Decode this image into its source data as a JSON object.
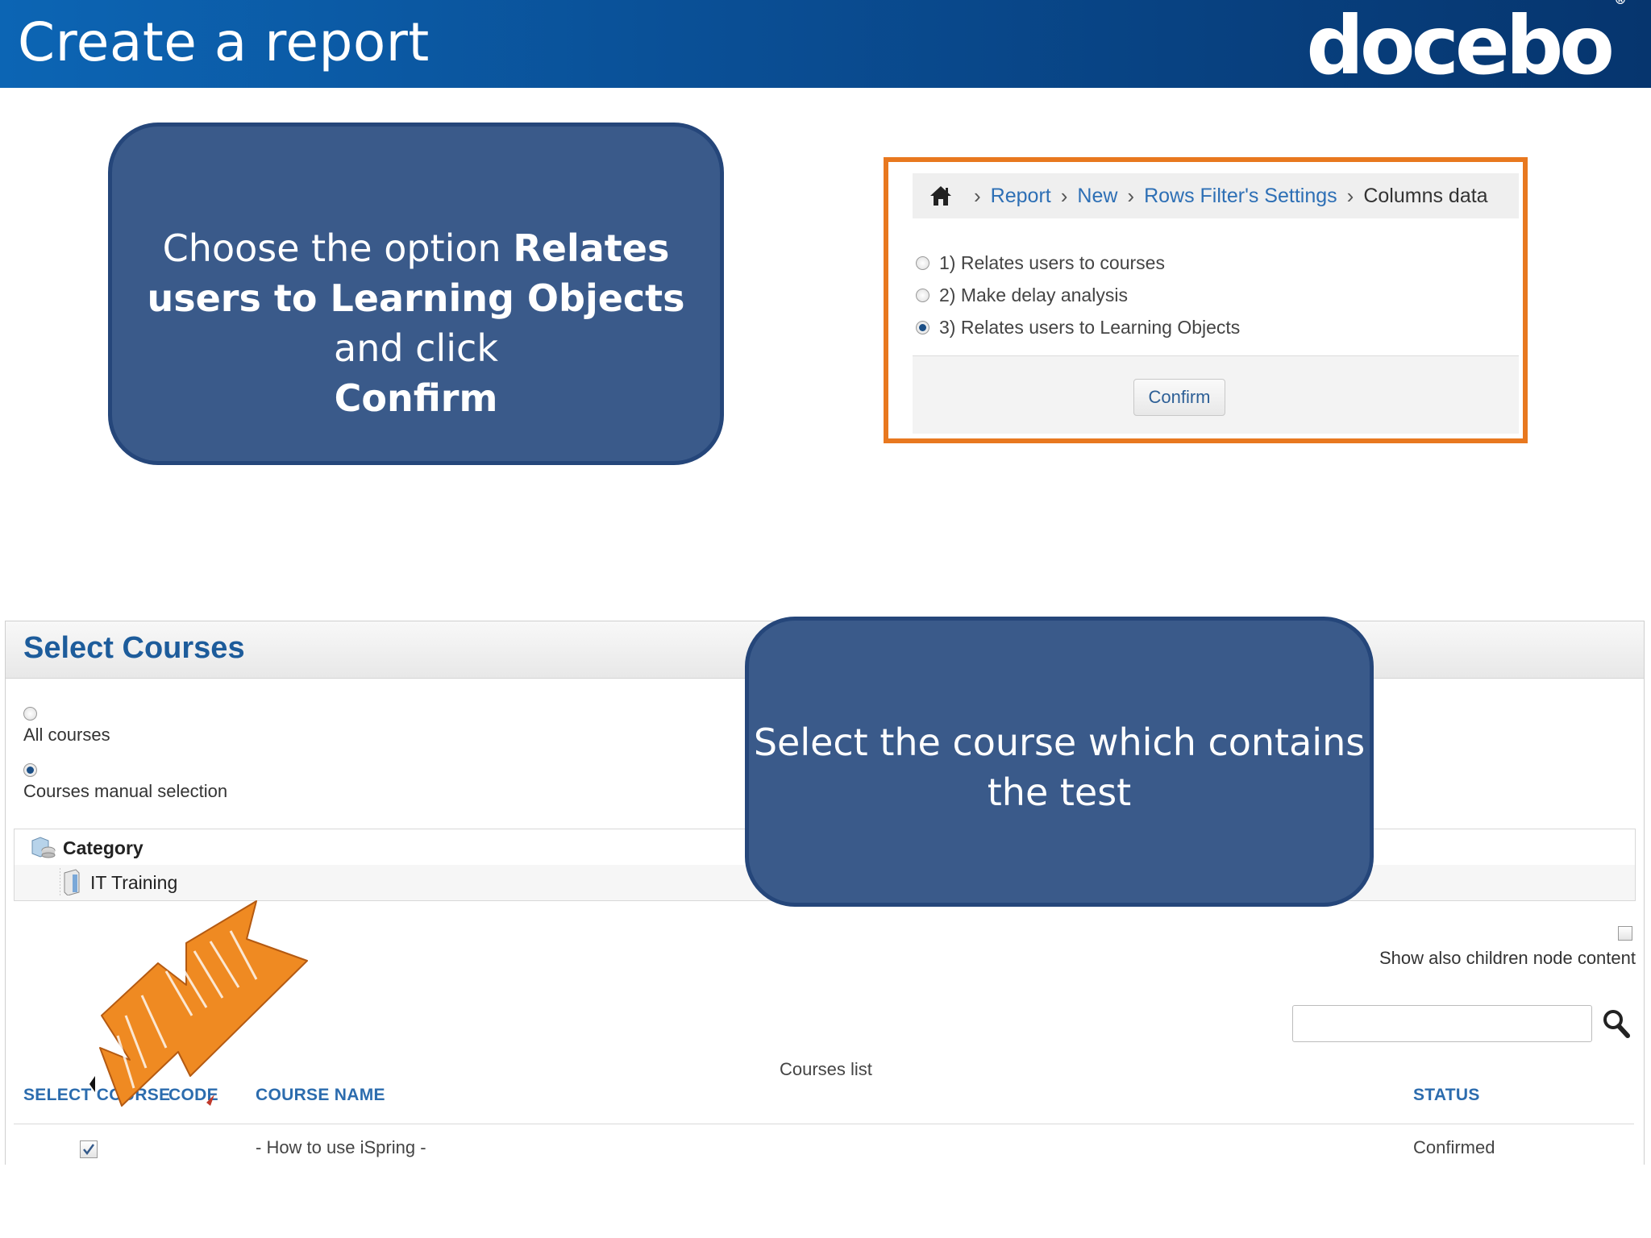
{
  "header": {
    "title": "Create a report",
    "logo_text": "docebo",
    "logo_mark": "®"
  },
  "callout_top": {
    "prefix": "Choose the option ",
    "bold1": "Relates users to Learning Objects",
    "mid": " and click ",
    "bold2": "Confirm"
  },
  "callout_bottom": {
    "text": "Select the course which contains the test"
  },
  "report_dialog": {
    "breadcrumb": [
      "Report",
      "New",
      "Rows Filter's Settings",
      "Columns data"
    ],
    "breadcrumb_sep": "›",
    "options": [
      {
        "label": "1) Relates users to courses",
        "selected": false
      },
      {
        "label": "2) Make delay analysis",
        "selected": false
      },
      {
        "label": "3) Relates users to Learning Objects",
        "selected": true
      }
    ],
    "confirm_label": "Confirm"
  },
  "select_courses": {
    "title": "Select Courses",
    "all_courses": "All courses",
    "manual_selection": "Courses manual selection",
    "tree": {
      "root": "Category",
      "child": "IT Training"
    },
    "show_children": "Show also children node content",
    "search_placeholder": "",
    "courses_list_caption": "Courses list",
    "columns": {
      "select": "SELECT COURSE",
      "code": "CODE",
      "name": "COURSE NAME",
      "status": "STATUS"
    },
    "rows": [
      {
        "checked": true,
        "code": "",
        "name": "- How to use iSpring -",
        "status": "Confirmed"
      }
    ]
  },
  "colors": {
    "header_blue": "#0a4e94",
    "callout_fill": "#3a5a8a",
    "frame_orange": "#e8781f",
    "link_blue": "#2d6fb5",
    "arrow_orange": "#ef8a22"
  },
  "icons": [
    "home-icon",
    "category-icon",
    "folder-icon",
    "search-icon",
    "hand-drawn-arrow-icon"
  ]
}
